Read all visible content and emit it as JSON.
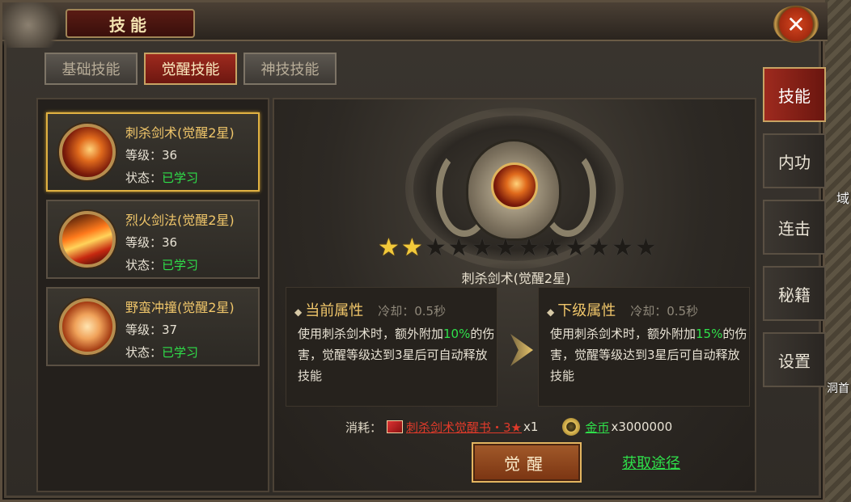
{
  "window": {
    "title": "技能"
  },
  "close": {
    "label": "✕"
  },
  "tabs": [
    {
      "label": "基础技能",
      "active": false
    },
    {
      "label": "觉醒技能",
      "active": true
    },
    {
      "label": "神技技能",
      "active": false
    }
  ],
  "skills": [
    {
      "name": "刺杀剑术(觉醒2星)",
      "level_label": "等级：",
      "level": "36",
      "status_label": "状态：",
      "status": "已学习",
      "icon": "thrust-slash-icon",
      "selected": true
    },
    {
      "name": "烈火剑法(觉醒2星)",
      "level_label": "等级：",
      "level": "36",
      "status_label": "状态：",
      "status": "已学习",
      "icon": "fire-sword-icon",
      "selected": false
    },
    {
      "name": "野蛮冲撞(觉醒2星)",
      "level_label": "等级：",
      "level": "37",
      "status_label": "状态：",
      "status": "已学习",
      "icon": "barbaric-charge-icon",
      "selected": false
    }
  ],
  "detail": {
    "stars_filled": 2,
    "stars_total": 12,
    "skill_name": "刺杀剑术(觉醒2星)",
    "current": {
      "title": "当前属性",
      "cooldown": "冷却：0.5秒",
      "desc_a": "使用刺杀剑术时，额外附加",
      "desc_num": "10%",
      "desc_b": "的伤害，觉醒等级达到3星后可自动释放技能"
    },
    "next": {
      "title": "下级属性",
      "cooldown": "冷却：0.5秒",
      "desc_a": "使用刺杀剑术时，额外附加",
      "desc_num": "15%",
      "desc_b": "的伤害，觉醒等级达到3星后可自动释放技能"
    },
    "cost_label": "消耗：",
    "cost_item": "刺杀剑术觉醒书・3★",
    "cost_item_count": "x1",
    "gold_name": "金币",
    "gold_amount": "x3000000",
    "awaken_button": "觉醒",
    "obtain_link": "获取途径"
  },
  "side_tabs": [
    {
      "label": "技能",
      "active": true
    },
    {
      "label": "内功",
      "active": false
    },
    {
      "label": "连击",
      "active": false
    },
    {
      "label": "秘籍",
      "active": false
    },
    {
      "label": "设置",
      "active": false
    }
  ],
  "world_text": {
    "a": "域",
    "b": "洞首"
  },
  "colors": {
    "accent_red": "#9e2a1e",
    "gold": "#f0c66a",
    "green": "#2fe04a",
    "cost_red": "#e03a2a"
  }
}
